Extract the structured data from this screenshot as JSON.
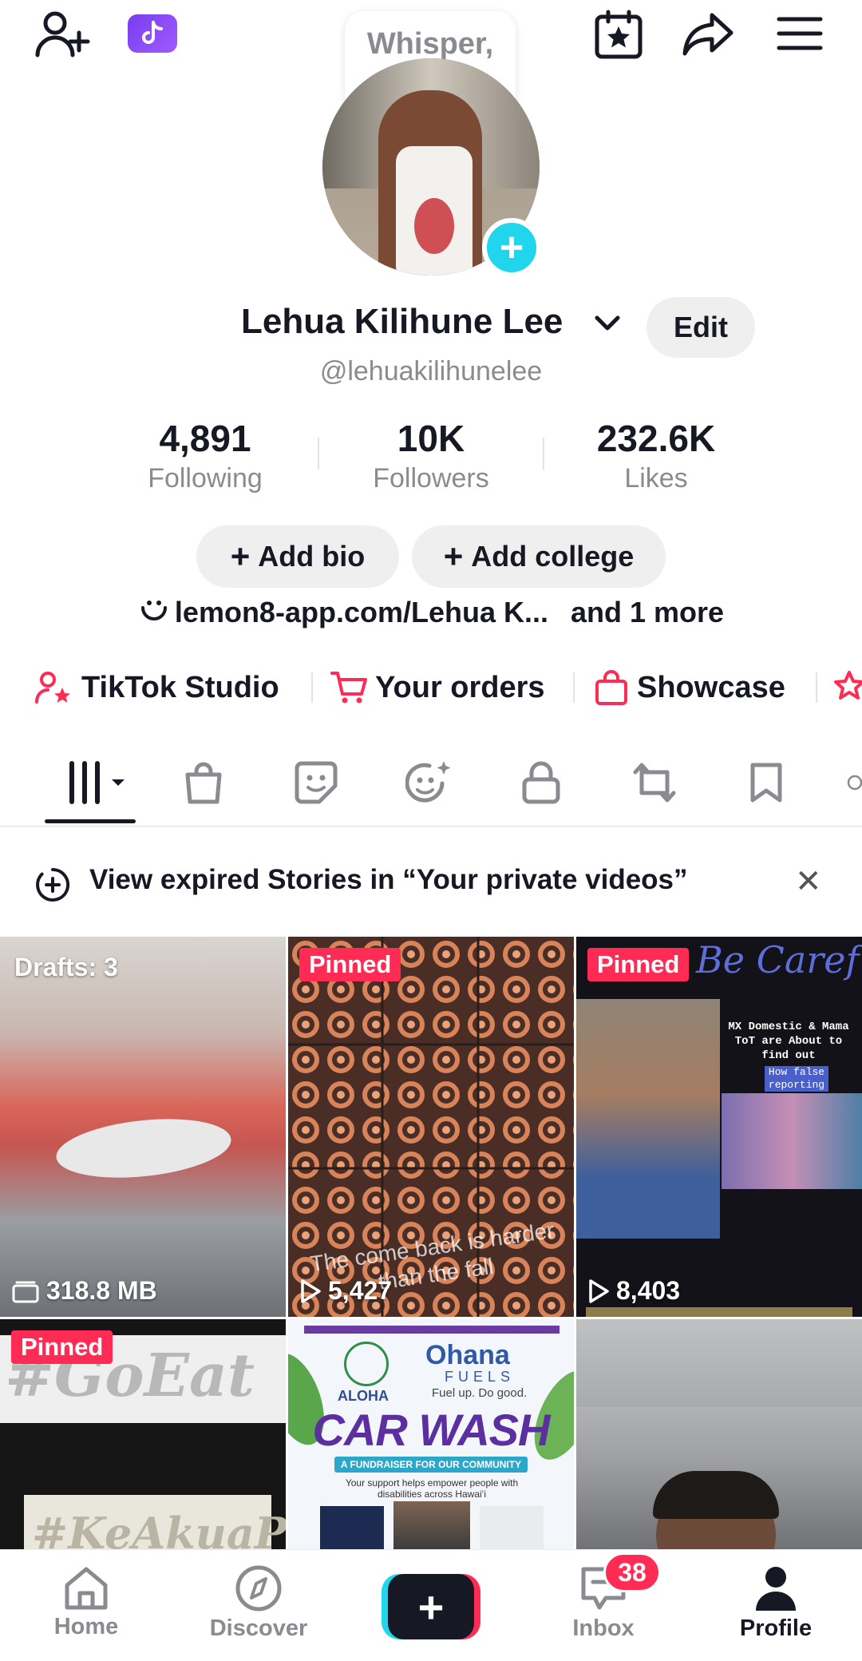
{
  "top_bar": {
    "bubble_text": "Whisper, whisper"
  },
  "profile": {
    "display_name": "Lehua Kilihune Lee",
    "edit_label": "Edit",
    "handle": "@lehuakilihunelee"
  },
  "stats": [
    {
      "value": "4,891",
      "label": "Following"
    },
    {
      "value": "10K",
      "label": "Followers"
    },
    {
      "value": "232.6K",
      "label": "Likes"
    }
  ],
  "bio_actions": {
    "add_bio": "Add bio",
    "add_college": "Add college"
  },
  "link": {
    "text": "lemon8-app.com/Lehua K...",
    "more": "and 1 more"
  },
  "quick_links": [
    {
      "label": "TikTok Studio"
    },
    {
      "label": "Your orders"
    },
    {
      "label": "Showcase"
    }
  ],
  "banner": {
    "text": "View expired Stories in “Your private videos”"
  },
  "grid": {
    "tile1": {
      "drafts": "Drafts: 3",
      "size": "318.8 MB"
    },
    "tile2": {
      "badge": "Pinned",
      "caption": "The come back is harder than the fall",
      "views": "5,427"
    },
    "tile3": {
      "badge": "Pinned",
      "script_top": "Be Carefu",
      "text_block": "MX Domestic & Mama ToT are About to find out",
      "highlight": "How false reporting",
      "views": "8,403"
    },
    "tile4": {
      "badge": "Pinned",
      "line1": "#GoEat",
      "line2": "#KeAkuaPū"
    },
    "tile5": {
      "brand": "Ohana",
      "brand_sub": "FUELS",
      "tagline": "Fuel up. Do good.",
      "aloha": "ALOHA",
      "title": "CAR WASH",
      "subtitle": "A FUNDRAISER FOR OUR COMMUNITY",
      "body": "Your support helps empower people with disabilities across Hawaiʻi"
    }
  },
  "bottom_nav": {
    "home": "Home",
    "discover": "Discover",
    "inbox": "Inbox",
    "inbox_badge": "38",
    "profile": "Profile"
  }
}
